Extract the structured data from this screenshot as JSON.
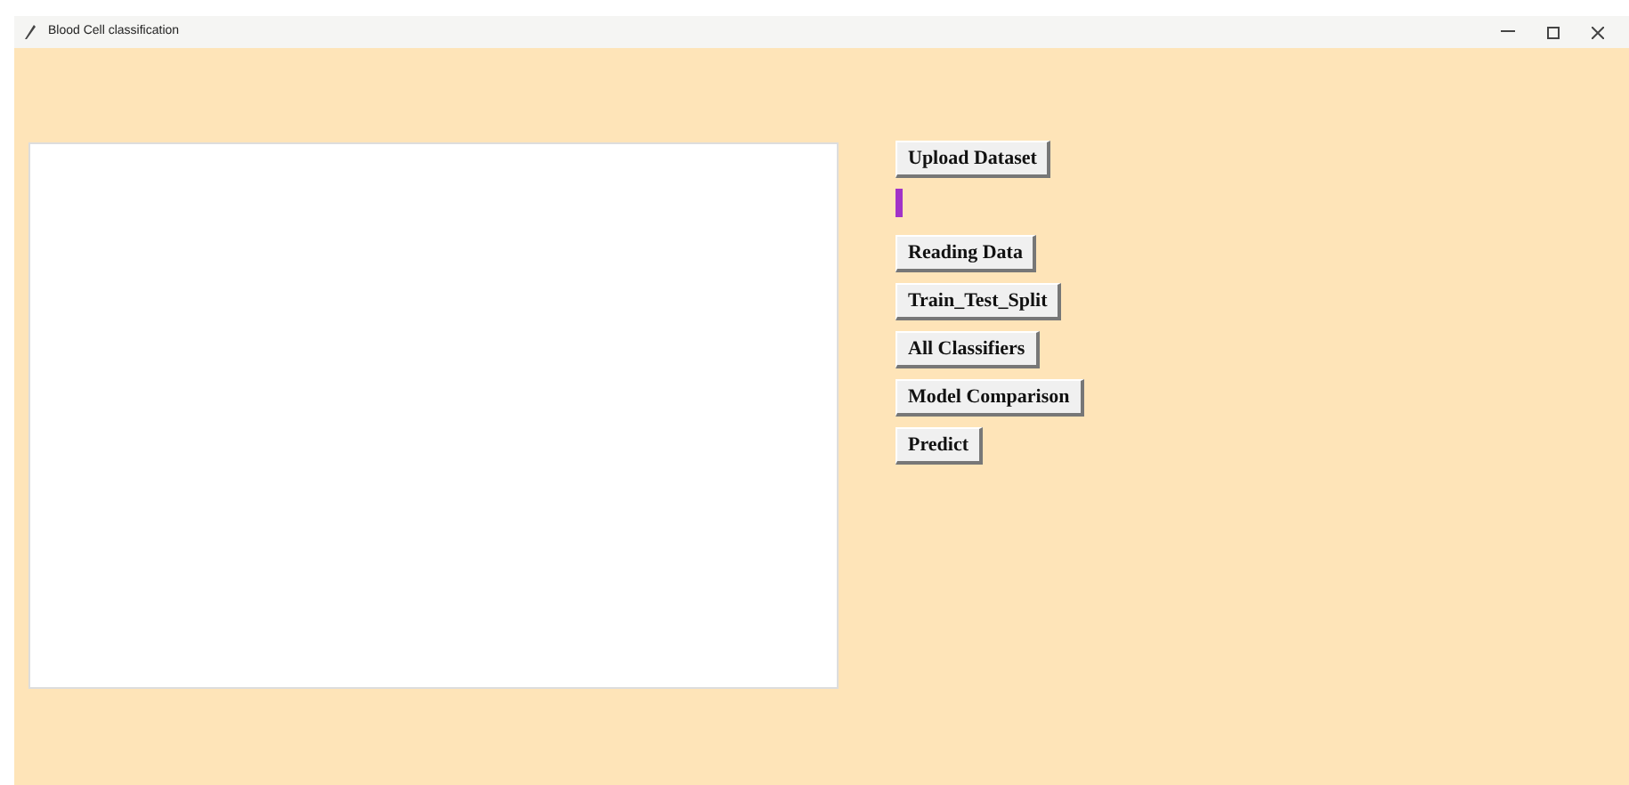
{
  "window": {
    "title": "Blood Cell classification"
  },
  "buttons": [
    "Upload Dataset",
    "Reading Data",
    "Train_Test_Split",
    "All Classifiers",
    "Model Comparison",
    "Predict"
  ]
}
